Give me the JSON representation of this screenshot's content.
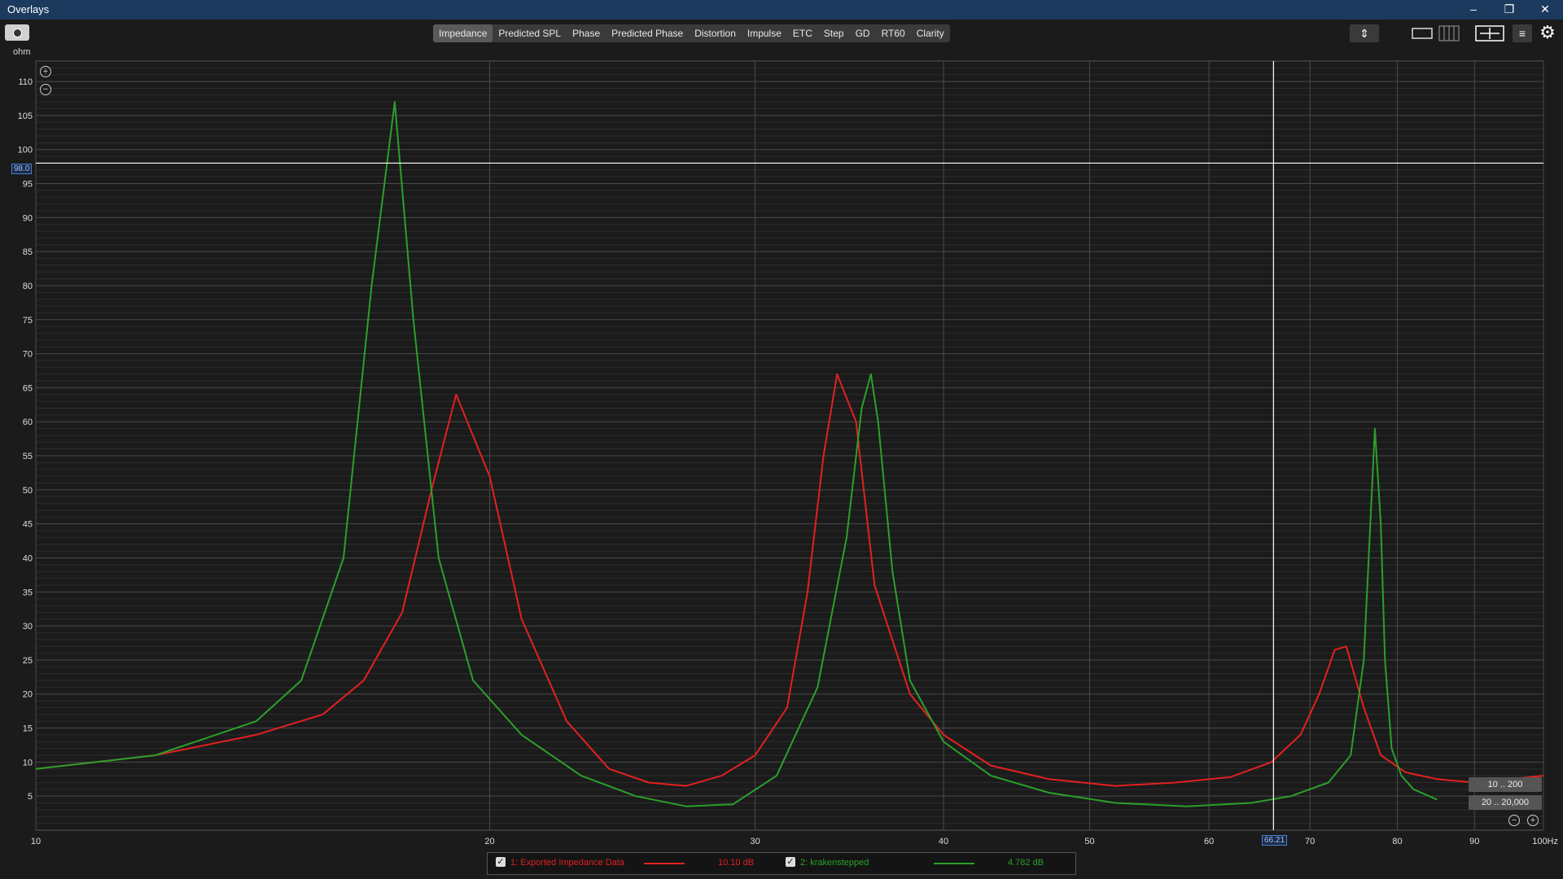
{
  "window": {
    "title": "Overlays",
    "minimize": "–",
    "restore": "❐",
    "close": "✕"
  },
  "toolbar": {
    "tabs": [
      "Impedance",
      "Predicted SPL",
      "Phase",
      "Predicted Phase",
      "Distortion",
      "Impulse",
      "ETC",
      "Step",
      "GD",
      "RT60",
      "Clarity"
    ],
    "active_tab": "Impedance",
    "icons": [
      "camera-icon",
      "vertical-scale-icon",
      "single-layout-icon",
      "multi-layout-icon",
      "fit-icon",
      "list-icon",
      "gear-icon"
    ]
  },
  "plot": {
    "y_unit": "ohm",
    "x_unit": "Hz",
    "cursor_y": "98.0",
    "cursor_x": "66.21",
    "range_buttons": [
      "10 .. 200",
      "20 .. 20,000"
    ],
    "colors": {
      "background": "#1b1b1b",
      "grid_major": "#4a4a4a",
      "grid_minor": "#2c2c2c",
      "cursor": "#ffffff"
    }
  },
  "legend": {
    "items": [
      {
        "label": "1: Exported Impedance Data",
        "value": "10.10 dB",
        "color": "#e32020"
      },
      {
        "label": "2: krakenstepped",
        "value": "4.782 dB",
        "color": "#2aa02a"
      }
    ]
  },
  "chart_data": {
    "type": "line",
    "x_scale": "log",
    "xlim": [
      10,
      100
    ],
    "ylim": [
      0,
      113
    ],
    "x_ticks": [
      "10",
      "20",
      "30",
      "40",
      "50",
      "60",
      "70",
      "80",
      "90",
      "100Hz"
    ],
    "x_tick_values": [
      10,
      20,
      30,
      40,
      50,
      60,
      70,
      80,
      90,
      100
    ],
    "y_ticks": [
      5,
      10,
      15,
      20,
      25,
      30,
      35,
      40,
      45,
      50,
      55,
      60,
      65,
      70,
      75,
      80,
      85,
      90,
      95,
      100,
      105,
      110
    ],
    "grid": true,
    "series": [
      {
        "name": "1: Exported Impedance Data",
        "color": "#e32020",
        "x": [
          10,
          12,
          14,
          15.5,
          16.5,
          17.5,
          18.3,
          19,
          20,
          21,
          22.5,
          24,
          25.5,
          27,
          28.5,
          30,
          31.5,
          32.5,
          33.3,
          34,
          35,
          36,
          38,
          40,
          43,
          47,
          52,
          57,
          62,
          66,
          69,
          71,
          72.7,
          74,
          76,
          78,
          81,
          85,
          90,
          100
        ],
        "y": [
          9,
          11,
          14,
          17,
          22,
          32,
          50,
          64,
          52,
          31,
          16,
          9,
          7,
          6.5,
          8,
          11,
          18,
          35,
          55,
          67,
          60,
          36,
          20,
          14,
          9.5,
          7.5,
          6.5,
          7,
          7.8,
          10,
          14,
          20,
          26.5,
          27,
          18,
          11,
          8.5,
          7.5,
          7,
          8
        ]
      },
      {
        "name": "2: krakenstepped",
        "color": "#2aa02a",
        "x": [
          10,
          12,
          14,
          15,
          16,
          16.7,
          17.3,
          17.8,
          18.5,
          19.5,
          21,
          23,
          25,
          27,
          29,
          31,
          33,
          34.5,
          35.3,
          35.8,
          36.2,
          37,
          38,
          40,
          43,
          47,
          52,
          58,
          64,
          68,
          72,
          74.5,
          76,
          77.3,
          78,
          78.5,
          79.3,
          80.5,
          82,
          85
        ],
        "y": [
          9,
          11,
          16,
          22,
          40,
          80,
          107,
          75,
          40,
          22,
          14,
          8,
          5,
          3.5,
          3.8,
          8,
          21,
          43,
          62,
          67,
          60,
          38,
          22,
          13,
          8,
          5.5,
          4,
          3.5,
          4,
          5,
          7,
          11,
          25,
          59,
          45,
          25,
          12,
          8,
          6,
          4.5
        ]
      }
    ]
  }
}
